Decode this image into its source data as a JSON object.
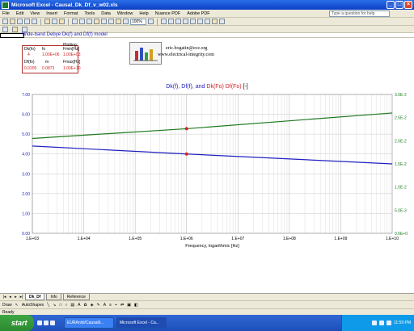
{
  "window": {
    "title": "Microsoft Excel - Causal_Dk_Df_v_w02.xls"
  },
  "menubar": {
    "items": [
      "File",
      "Edit",
      "View",
      "Insert",
      "Format",
      "Tools",
      "Data",
      "Window",
      "Help",
      "Nuance PDF",
      "Adobe PDF"
    ],
    "help_placeholder": "Type a question for help"
  },
  "toolbar": {
    "zoom": "100%"
  },
  "sheet": {
    "model_title": "Wide-band Debye Dk(f) and Df(f) model",
    "params": {
      "dkfo_label": "Dk(fo)",
      "fo_label": "fo",
      "plotting_label": "Plotting:",
      "fmin_label": "Fmin[Hz]",
      "dkfo_value": "4",
      "fo_value": "1.00E+06",
      "fmin_value": "1.00E+03",
      "dffo_label": "Df(fo)",
      "m_label": "m",
      "fmax_label": "Fmax[Hz]",
      "dffo_value": "0.0205",
      "m_value": "0.0873",
      "fmax_value": "1.00E+10"
    },
    "logo": {
      "email": "eric.bogatin@ece.org",
      "website": "www.electrical-integrity.com"
    }
  },
  "chart_data": {
    "type": "line",
    "title_parts": [
      "Dk(f), Df(f), and",
      "Dk(Fo) Df(Fo)",
      "[-]"
    ],
    "xlabel": "Frequency, logarithmic [Hz]",
    "xscale": "log",
    "xlim": [
      1000,
      10000000000
    ],
    "x_ticks": [
      "1.E+03",
      "1.E+04",
      "1.E+05",
      "1.E+06",
      "1.E+07",
      "1.E+08",
      "1.E+09",
      "1.E+10"
    ],
    "ylim": [
      0,
      7
    ],
    "y_ticks": [
      "0.00",
      "1.00",
      "2.00",
      "3.00",
      "4.00",
      "5.00",
      "6.00",
      "7.00"
    ],
    "y2lim": [
      0,
      0.03
    ],
    "y2_ticks": [
      "0.0E+0",
      "5.0E-3",
      "1.0E-2",
      "1.5E-2",
      "2.0E-2",
      "2.5E-2",
      "3.0E-2"
    ],
    "series": [
      {
        "values_x": [
          1000,
          1000000,
          10000000000
        ],
        "values_y": [
          4.4,
          4.0,
          3.5
        ],
        "color": "#2020c0",
        "axis": "left"
      },
      {
        "values_x": [
          1000,
          1000000,
          10000000000
        ],
        "values_y": [
          0.0205,
          0.0226,
          0.026
        ],
        "color": "#1f7a1f",
        "axis": "right"
      }
    ],
    "markers": [
      {
        "x": 1000000,
        "y": 4.0,
        "axis": "left",
        "color": "#e02020"
      },
      {
        "x": 1000000,
        "y": 0.0226,
        "axis": "right",
        "color": "#e02020"
      }
    ],
    "grid": true
  },
  "tabs": {
    "items": [
      "Dk_Df",
      "Info",
      "Reference"
    ],
    "active": 0
  },
  "drawbar": {
    "draw_label": "Draw",
    "autoshapes_label": "AutoShapes"
  },
  "status": {
    "text": "Ready"
  },
  "taskbar": {
    "start_label": "start",
    "tasks": [
      "EURAnlst/Causalit...",
      "Microsoft Excel - Ca..."
    ],
    "clock": "11:59 PM"
  }
}
